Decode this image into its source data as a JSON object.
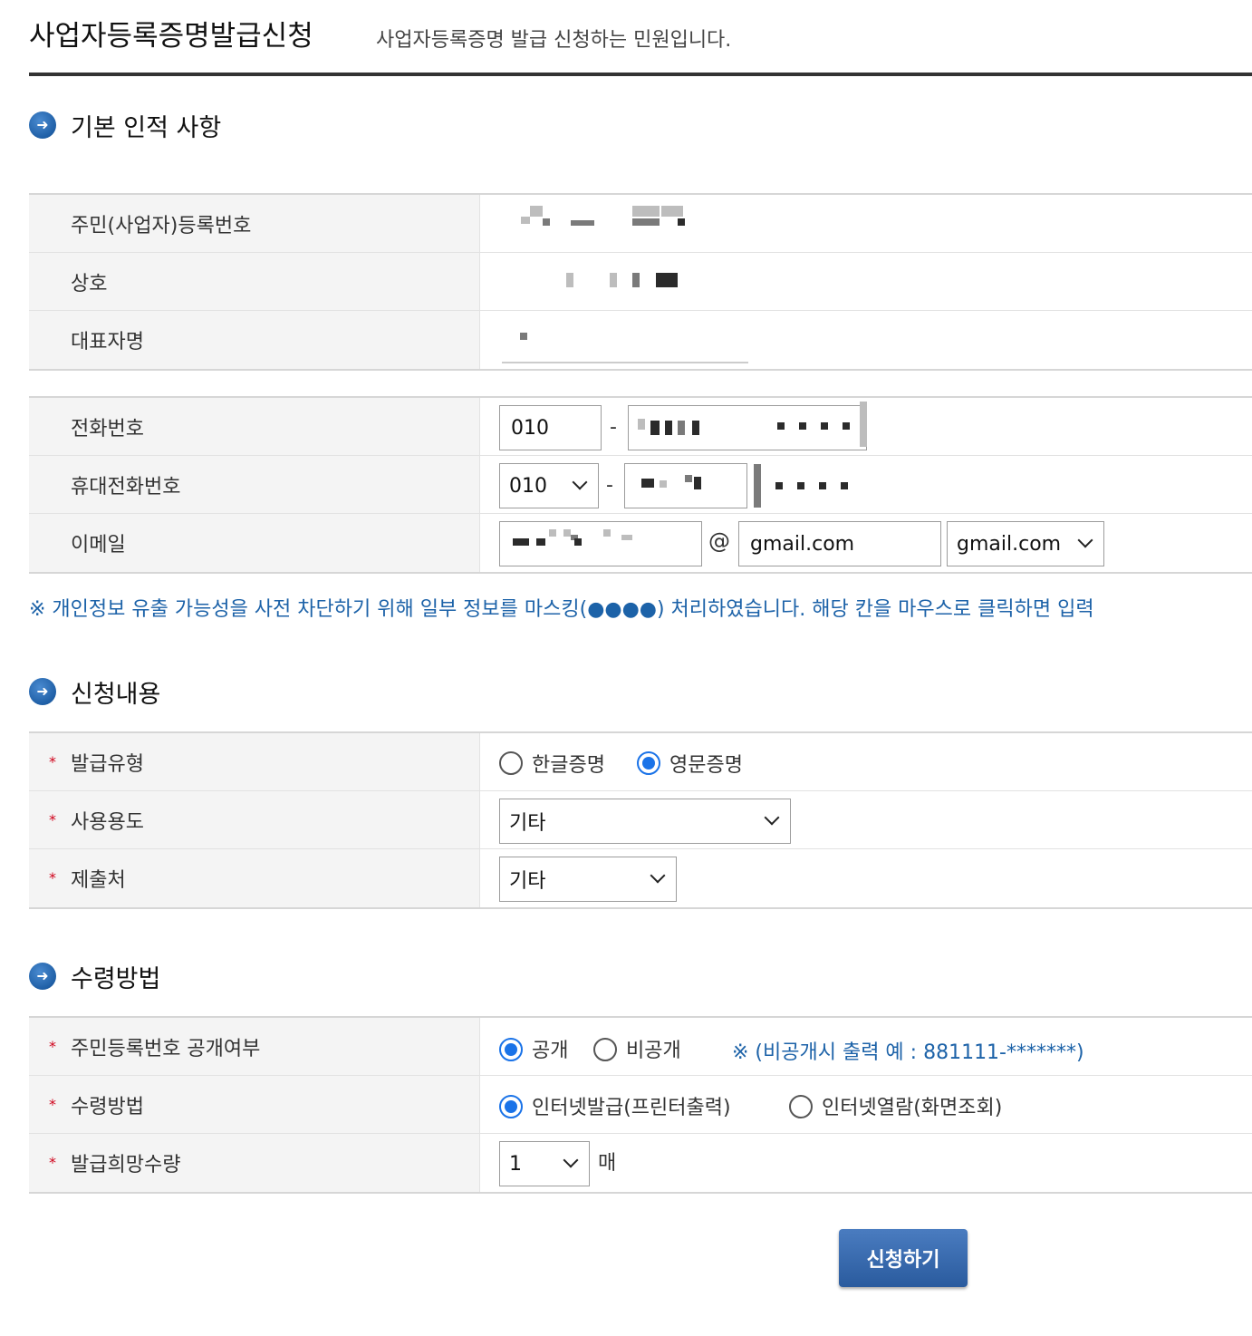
{
  "header": {
    "title": "사업자등록증명발급신청",
    "description": "사업자등록증명 발급 신청하는 민원입니다."
  },
  "section_basic": {
    "title": "기본 인적 사항",
    "rows": [
      {
        "label": "주민(사업자)등록번호"
      },
      {
        "label": "상호"
      },
      {
        "label": "대표자명"
      }
    ]
  },
  "contact": {
    "phone": {
      "label": "전화번호",
      "prefix": "010",
      "dash": "-"
    },
    "mobile": {
      "label": "휴대전화번호",
      "prefix": "010",
      "dash": "-"
    },
    "email": {
      "label": "이메일",
      "at": "@",
      "domain": "gmail.com",
      "domain_select": "gmail.com"
    }
  },
  "notice": "※ 개인정보 유출 가능성을 사전 차단하기 위해 일부 정보를 마스킹(●●●●) 처리하였습니다. 해당 칸을 마우스로 클릭하면 입력",
  "section_request": {
    "title": "신청내용",
    "issue_type": {
      "label": "발급유형",
      "options": [
        "한글증명",
        "영문증명"
      ],
      "selected": "영문증명"
    },
    "usage": {
      "label": "사용용도",
      "value": "기타"
    },
    "submit_to": {
      "label": "제출처",
      "value": "기타"
    }
  },
  "section_receive": {
    "title": "수령방법",
    "disclosure": {
      "label": "주민등록번호 공개여부",
      "options": [
        "공개",
        "비공개"
      ],
      "selected": "공개",
      "note": "※ (비공개시 출력 예 : 881111-*******)"
    },
    "method": {
      "label": "수령방법",
      "options": [
        "인터넷발급(프린터출력)",
        "인터넷열람(화면조회)"
      ],
      "selected": "인터넷발급(프린터출력)"
    },
    "quantity": {
      "label": "발급희망수량",
      "value": "1",
      "unit": "매"
    }
  },
  "buttons": {
    "submit": "신청하기"
  },
  "icons": {
    "section": "arrow-right-circle-icon",
    "required": "asterisk-icon",
    "dropdown": "chevron-down-icon"
  },
  "colors": {
    "accent_blue": "#1c62a8",
    "radio_blue": "#1a73e8",
    "required_red": "#d0021b",
    "button_blue": "#2a5b9e"
  }
}
